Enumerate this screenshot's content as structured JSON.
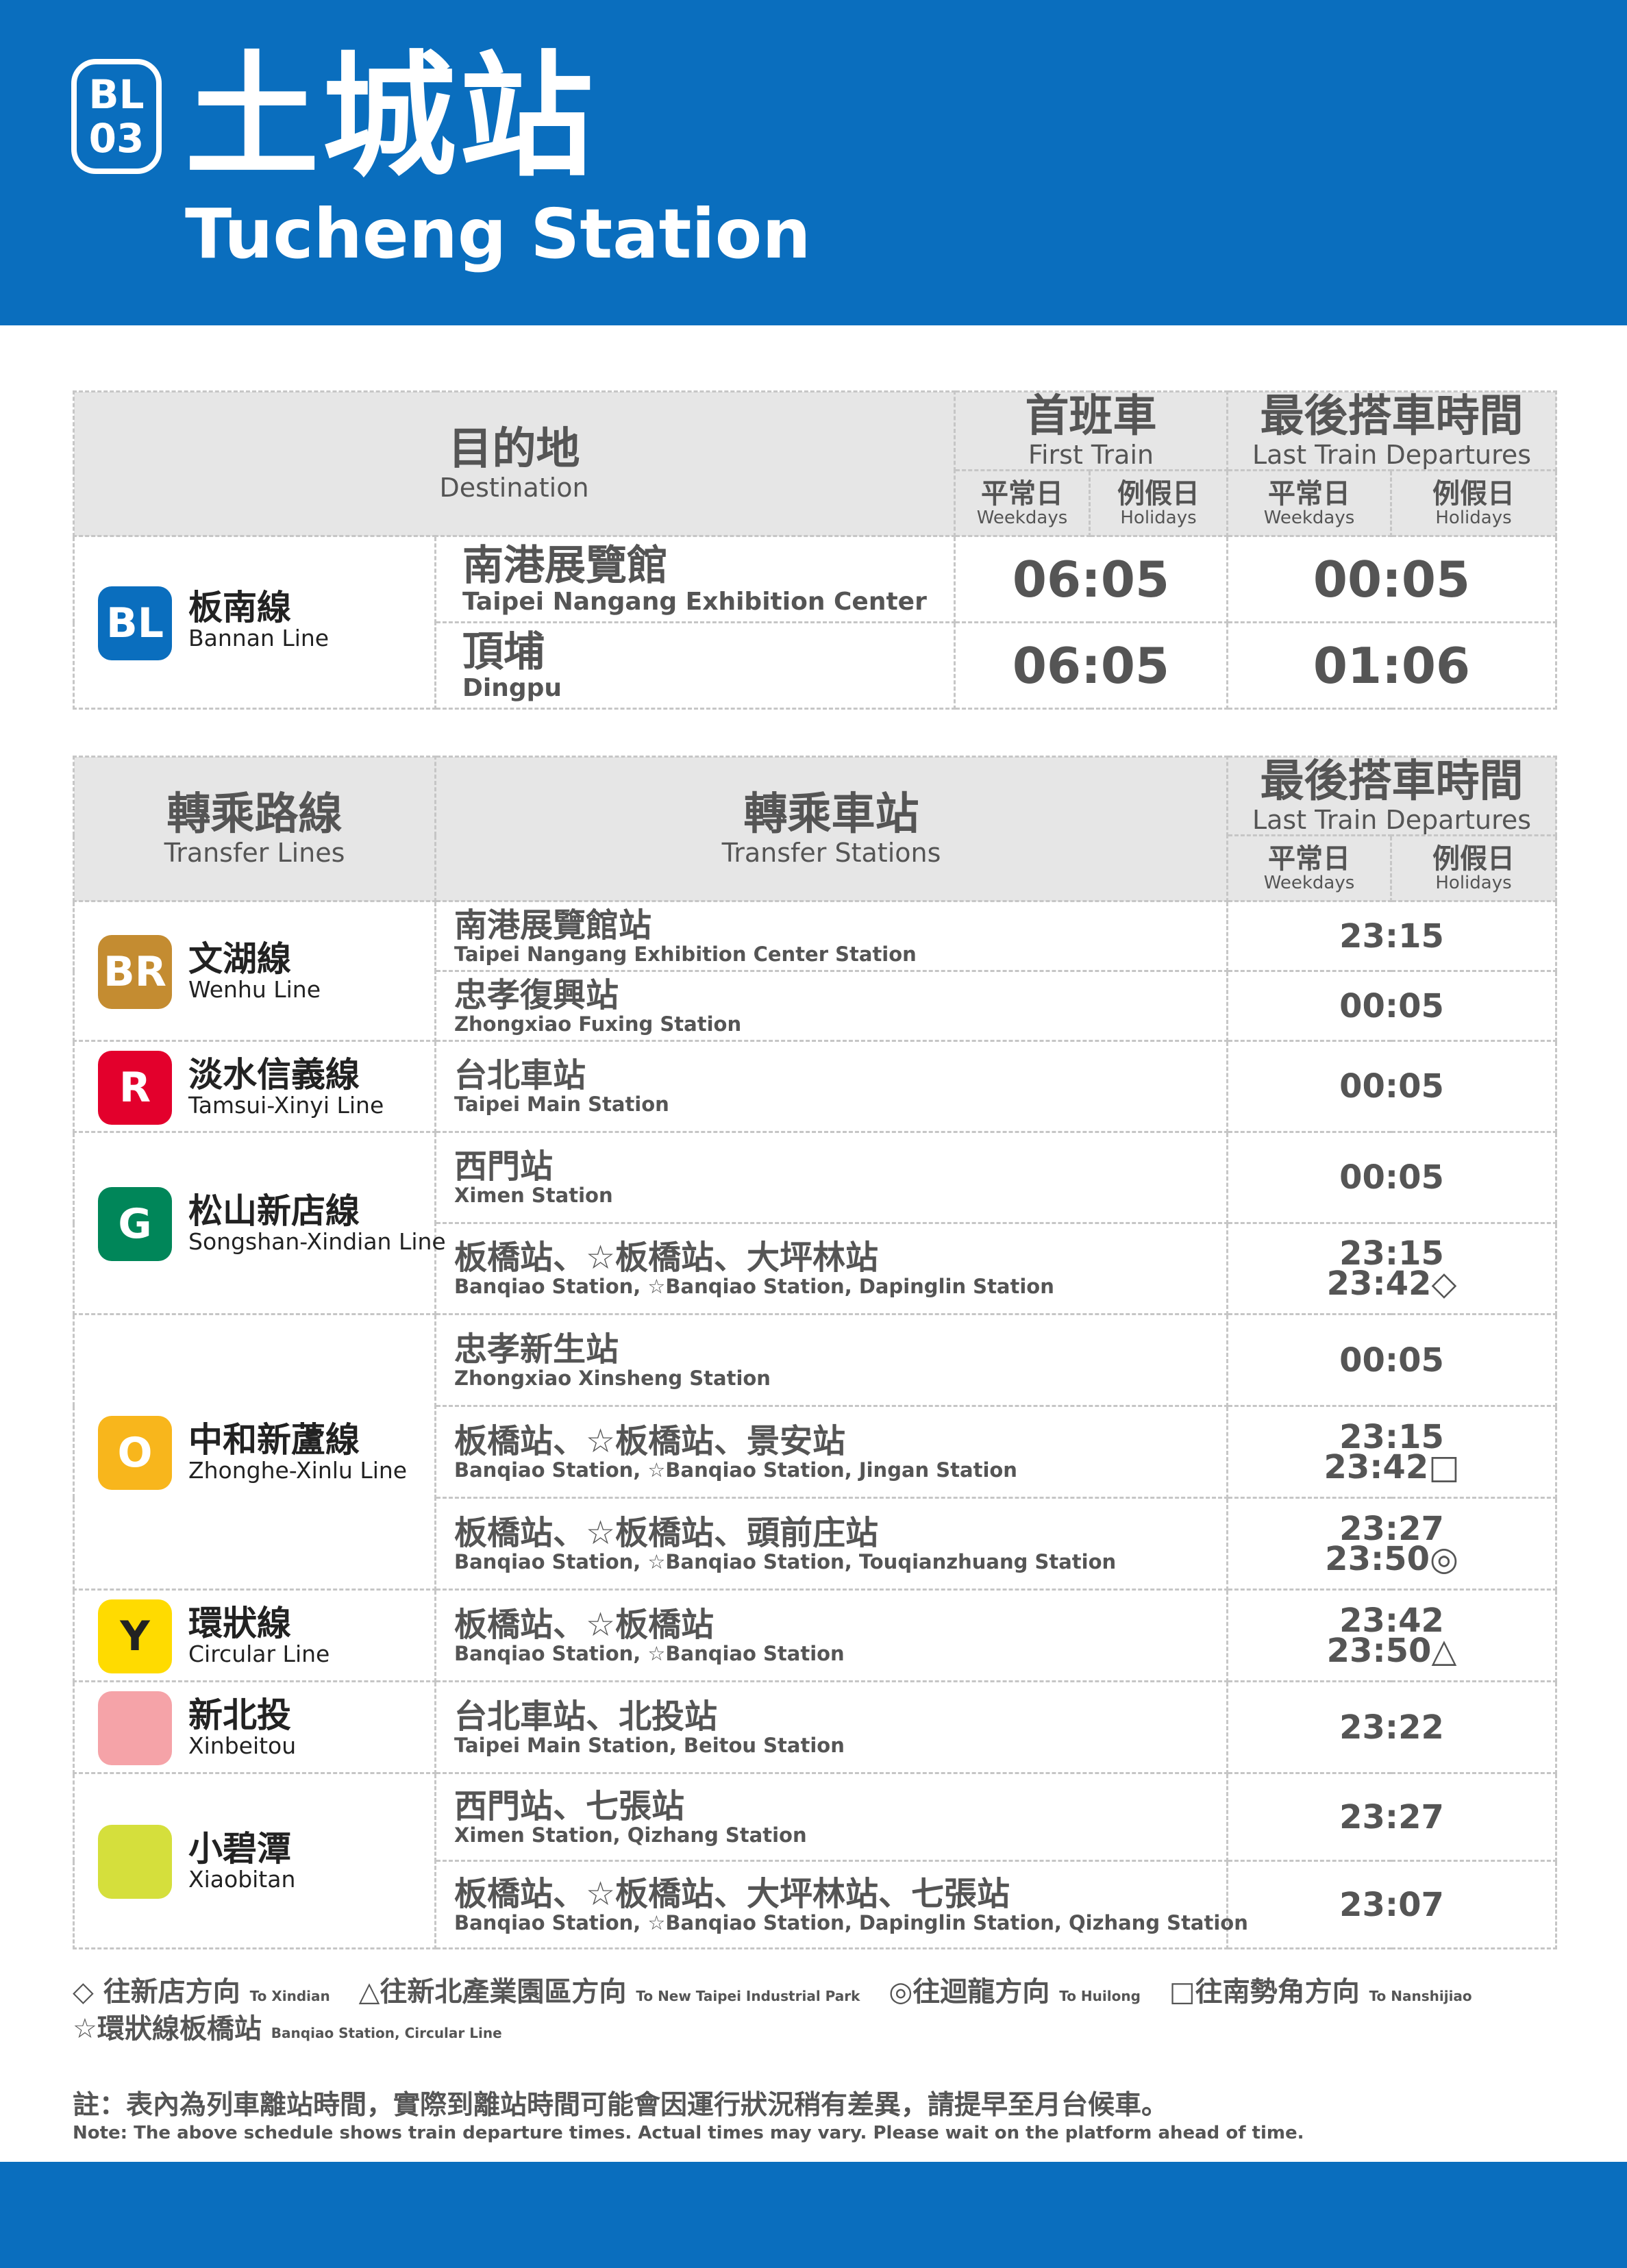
{
  "station": {
    "code_line": "BL",
    "code_num": "03",
    "name_zh": "土城站",
    "name_en": "Tucheng Station"
  },
  "main_table": {
    "destination_zh": "目的地",
    "destination_en": "Destination",
    "first_train_zh": "首班車",
    "first_train_en": "First Train",
    "last_train_zh": "最後搭車時間",
    "last_train_en": "Last Train Departures",
    "weekdays_zh": "平常日",
    "weekdays_en": "Weekdays",
    "holidays_zh": "例假日",
    "holidays_en": "Holidays",
    "line": {
      "badge": "BL",
      "name_zh": "板南線",
      "name_en": "Bannan Line",
      "color": "#0a6ebe"
    },
    "rows": [
      {
        "dest_zh": "南港展覽館",
        "dest_en": "Taipei Nangang Exhibition Center",
        "first": "06:05",
        "last": "00:05"
      },
      {
        "dest_zh": "頂埔",
        "dest_en": "Dingpu",
        "first": "06:05",
        "last": "01:06"
      }
    ]
  },
  "transfer_table": {
    "lines_zh": "轉乘路線",
    "lines_en": "Transfer Lines",
    "stations_zh": "轉乘車站",
    "stations_en": "Transfer Stations",
    "last_train_zh": "最後搭車時間",
    "last_train_en": "Last Train Departures",
    "weekdays_zh": "平常日",
    "weekdays_en": "Weekdays",
    "holidays_zh": "例假日",
    "holidays_en": "Holidays",
    "lines": [
      {
        "badge": "BR",
        "color": "#c48c31",
        "name_zh": "文湖線",
        "name_en": "Wenhu Line",
        "rows": [
          {
            "st_zh": "南港展覽館站",
            "st_en": "Taipei Nangang Exhibition Center Station",
            "t1": "23:15",
            "t2": ""
          },
          {
            "st_zh": "忠孝復興站",
            "st_en": "Zhongxiao Fuxing Station",
            "t1": "00:05",
            "t2": ""
          }
        ]
      },
      {
        "badge": "R",
        "color": "#e3002c",
        "name_zh": "淡水信義線",
        "name_en": "Tamsui-Xinyi Line",
        "rows": [
          {
            "st_zh": "台北車站",
            "st_en": "Taipei Main Station",
            "t1": "00:05",
            "t2": ""
          }
        ]
      },
      {
        "badge": "G",
        "color": "#008659",
        "name_zh": "松山新店線",
        "name_en": "Songshan-Xindian Line",
        "rows": [
          {
            "st_zh": "西門站",
            "st_en": "Ximen Station",
            "t1": "00:05",
            "t2": ""
          },
          {
            "st_zh": "板橋站、☆板橋站、大坪林站",
            "st_en": "Banqiao Station, ☆Banqiao Station, Dapinglin Station",
            "t1": "23:15",
            "t2": "23:42◇"
          }
        ]
      },
      {
        "badge": "O",
        "color": "#f8b61c",
        "name_zh": "中和新蘆線",
        "name_en": "Zhonghe-Xinlu Line",
        "rows": [
          {
            "st_zh": "忠孝新生站",
            "st_en": "Zhongxiao Xinsheng Station",
            "t1": "00:05",
            "t2": ""
          },
          {
            "st_zh": "板橋站、☆板橋站、景安站",
            "st_en": "Banqiao Station, ☆Banqiao Station, Jingan Station",
            "t1": "23:15",
            "t2": "23:42□"
          },
          {
            "st_zh": "板橋站、☆板橋站、頭前庄站",
            "st_en": "Banqiao Station, ☆Banqiao Station, Touqianzhuang Station",
            "t1": "23:27",
            "t2": "23:50◎"
          }
        ]
      },
      {
        "badge": "Y",
        "color": "#ffdb00",
        "name_zh": "環狀線",
        "name_en": "Circular Line",
        "rows": [
          {
            "st_zh": "板橋站、☆板橋站",
            "st_en": "Banqiao Station, ☆Banqiao Station",
            "t1": "23:42",
            "t2": "23:50△"
          }
        ]
      },
      {
        "badge": "",
        "color": "#f5a3a8",
        "name_zh": "新北投",
        "name_en": "Xinbeitou",
        "rows": [
          {
            "st_zh": "台北車站、北投站",
            "st_en": "Taipei Main Station, Beitou Station",
            "t1": "23:22",
            "t2": ""
          }
        ]
      },
      {
        "badge": "",
        "color": "#d5df3c",
        "name_zh": "小碧潭",
        "name_en": "Xiaobitan",
        "rows": [
          {
            "st_zh": "西門站、七張站",
            "st_en": "Ximen Station, Qizhang Station",
            "t1": "23:27",
            "t2": ""
          },
          {
            "st_zh": "板橋站、☆板橋站、大坪林站、七張站",
            "st_en": "Banqiao Station, ☆Banqiao Station, Dapinglin Station, Qizhang Station",
            "t1": "23:07",
            "t2": ""
          }
        ]
      }
    ]
  },
  "legend": {
    "items": [
      {
        "zh": "◇ 往新店方向",
        "en": "To Xindian"
      },
      {
        "zh": "△往新北產業園區方向",
        "en": "To New Taipei Industrial Park"
      },
      {
        "zh": "◎往迴龍方向",
        "en": "To Huilong"
      },
      {
        "zh": "□往南勢角方向",
        "en": "To Nanshijiao"
      }
    ],
    "star_zh": "☆環狀線板橋站",
    "star_en": "Banqiao Station, Circular Line"
  },
  "note": {
    "zh": "註：表內為列車離站時間，實際到離站時間可能會因運行狀況稍有差異，請提早至月台候車。",
    "en": "Note: The above schedule shows train departure times. Actual times may vary. Please wait on the platform ahead of time."
  }
}
